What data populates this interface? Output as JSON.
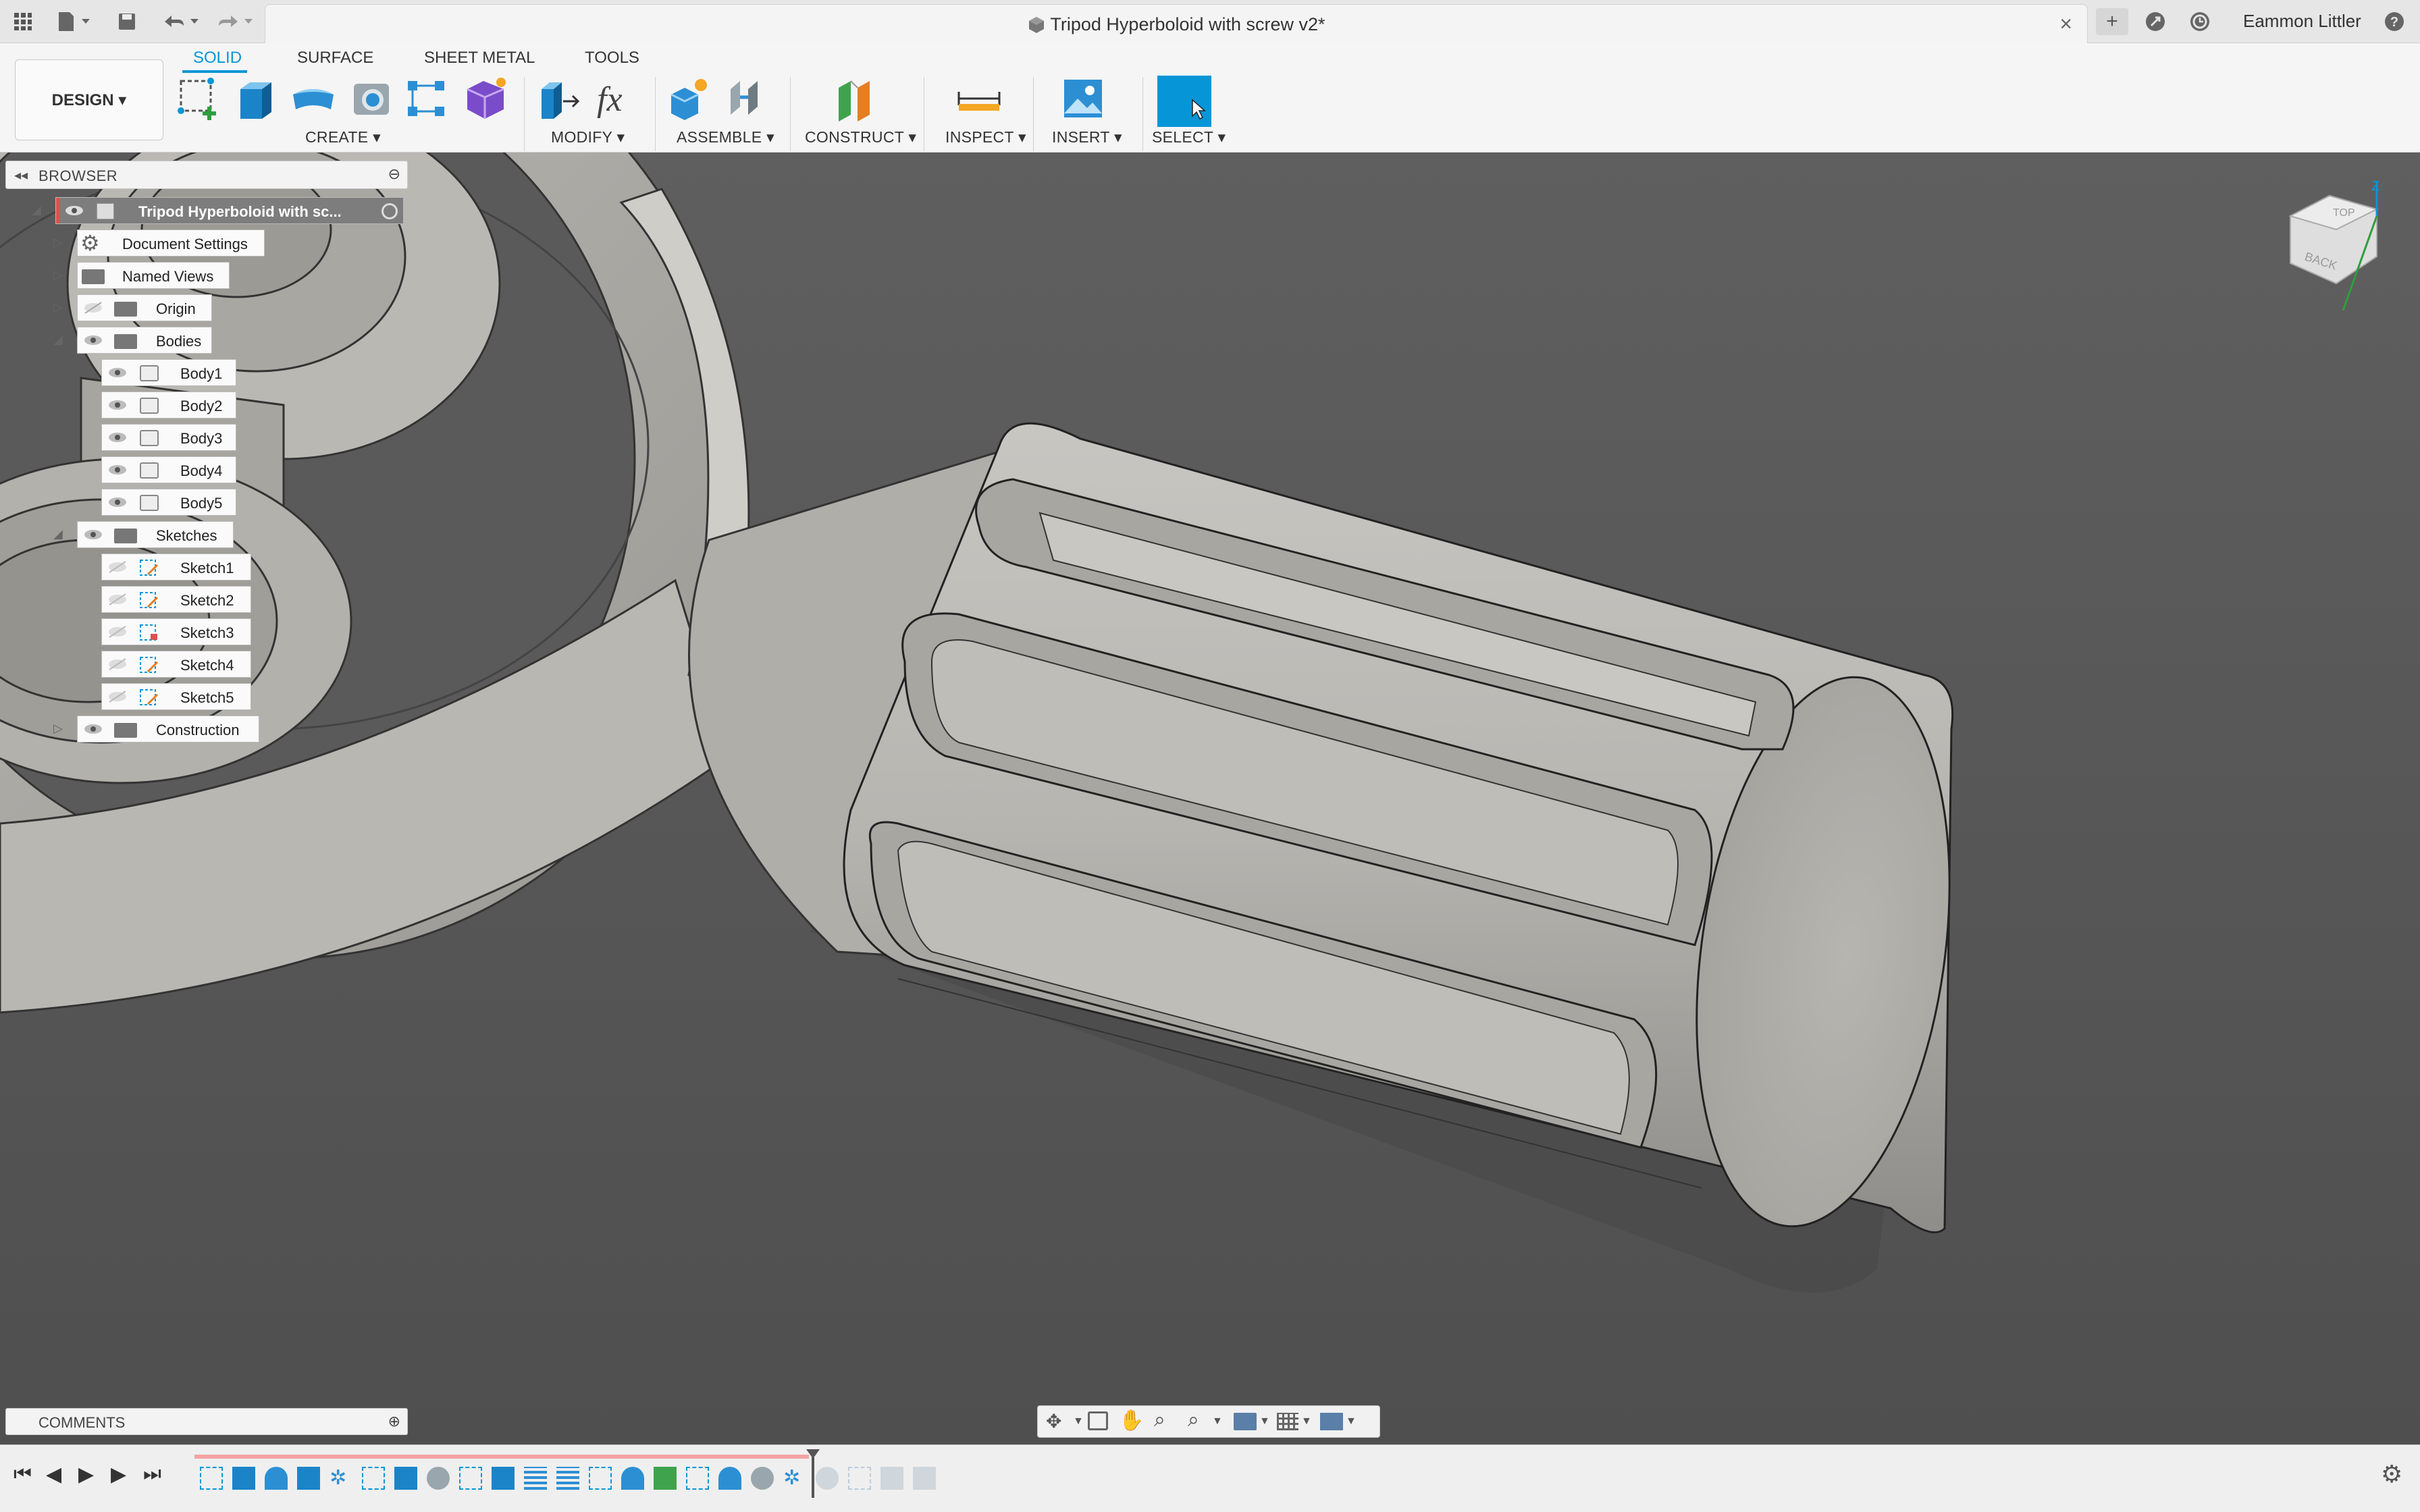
{
  "titlebar": {
    "document_title": "Tripod Hyperboloid with screw v2*",
    "user_name": "Eammon Littler",
    "icons": [
      "grid-icon",
      "file-icon",
      "save-icon",
      "undo-icon",
      "redo-icon",
      "close-icon",
      "plus-icon",
      "job-status-icon",
      "clock-icon",
      "help-icon"
    ]
  },
  "toolbar": {
    "tabs": [
      {
        "label": "SOLID",
        "active": true
      },
      {
        "label": "SURFACE"
      },
      {
        "label": "SHEET METAL"
      },
      {
        "label": "TOOLS"
      }
    ],
    "workspace": "DESIGN ▾",
    "groups": {
      "create": "CREATE ▾",
      "modify": "MODIFY ▾",
      "assemble": "ASSEMBLE ▾",
      "construct": "CONSTRUCT ▾",
      "inspect": "INSPECT ▾",
      "insert": "INSERT ▾",
      "select": "SELECT ▾"
    },
    "accent_color": "#0696d7"
  },
  "browser": {
    "title": "BROWSER",
    "root": "Tripod Hyperboloid with sc...",
    "items": {
      "document_settings": "Document Settings",
      "named_views": "Named Views",
      "origin": "Origin",
      "bodies": "Bodies",
      "body1": "Body1",
      "body2": "Body2",
      "body3": "Body3",
      "body4": "Body4",
      "body5": "Body5",
      "sketches": "Sketches",
      "sketch1": "Sketch1",
      "sketch2": "Sketch2",
      "sketch3": "Sketch3",
      "sketch4": "Sketch4",
      "sketch5": "Sketch5",
      "construction": "Construction"
    }
  },
  "viewcube": {
    "face_top": "TOP",
    "face_back": "BACK",
    "axis_z": "Z"
  },
  "comments": {
    "label": "COMMENTS"
  },
  "timeline": {
    "controls": [
      "skip-start-icon",
      "step-back-icon",
      "play-icon",
      "step-forward-icon",
      "skip-end-icon"
    ]
  }
}
